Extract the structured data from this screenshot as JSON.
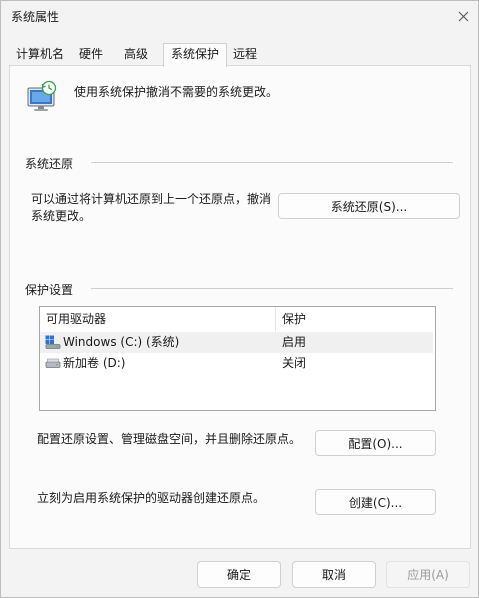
{
  "window": {
    "title": "系统属性"
  },
  "tabs": [
    {
      "label": "计算机名"
    },
    {
      "label": "硬件"
    },
    {
      "label": "高级"
    },
    {
      "label": "系统保护"
    },
    {
      "label": "远程"
    }
  ],
  "header": {
    "description": "使用系统保护撤消不需要的系统更改。"
  },
  "restore": {
    "group_title": "系统还原",
    "text_line1": "可以通过将计算机还原到上一个还原点，撤消",
    "text_line2": "系统更改。",
    "button_label": "系统还原(S)..."
  },
  "protection": {
    "group_title": "保护设置",
    "columns": [
      "可用驱动器",
      "保护"
    ],
    "rows": [
      {
        "drive": "Windows (C:) (系统)",
        "status": "启用",
        "icon": "system-drive-icon"
      },
      {
        "drive": "新加卷 (D:)",
        "status": "关闭",
        "icon": "local-drive-icon"
      }
    ],
    "configure_text": "配置还原设置、管理磁盘空间，并且删除还原点。",
    "configure_button": "配置(O)...",
    "create_text": "立刻为启用系统保护的驱动器创建还原点。",
    "create_button": "创建(C)..."
  },
  "footer": {
    "ok": "确定",
    "cancel": "取消",
    "apply": "应用(A)"
  },
  "icons": {
    "header": "system-protection-computer-icon",
    "close": "close-icon"
  }
}
